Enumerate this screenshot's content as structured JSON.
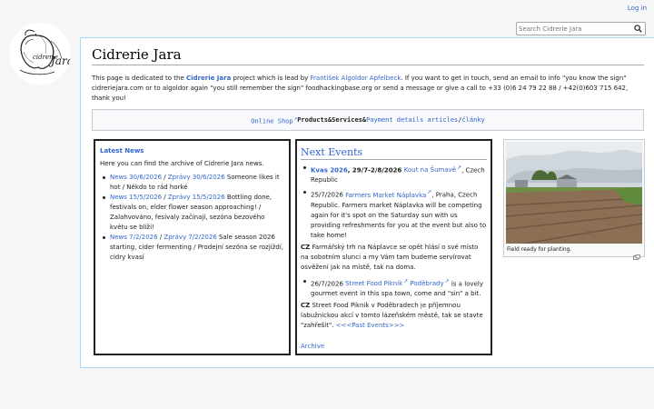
{
  "header": {
    "login_label": "Log in",
    "search_placeholder": "Search Cidrerie Jara"
  },
  "logo": {
    "text": "cidrerie Jara"
  },
  "page": {
    "title": "Cidrerie Jara",
    "intro": {
      "p1": "This page is dedicated to the ",
      "project_link": "Cidrerie Jara",
      "p2": " project which is lead by ",
      "person_link": "František Algoldor Apfelbeck",
      "p3": ". If you want to get in touch, send an email to info \"you know the sign\" cidreriejara.com or to algoldor again \"you still remember the sign\" foodhackingbase.org or send a message or give a call to +33 (0)6 24 79 22 88 / +42(0)603 715 642, thank you!"
    },
    "nav": {
      "online_shop": "Online Shop",
      "products": "Products",
      "services": "Services",
      "payment": "Payment details",
      "articles": "articles",
      "clanky": "články"
    }
  },
  "news": {
    "heading": "Latest News",
    "intro": "Here you can find the archive of Cidrerie Jara news.",
    "items": [
      {
        "link_en": "News 30/6/2026",
        "link_cz": "Zprávy 30/6/2026",
        "text": " Someone likes it hot / Někdo to rád horké"
      },
      {
        "link_en": "News 15/5/2026",
        "link_cz": "Zprávy 15/5/2026",
        "text": " Bottling done, festivals on, elder flower season approaching! / Zalahvováno, fesivaly začínají, sezóna bezového květu se blíží!"
      },
      {
        "link_en": "News 7/2/2026",
        "link_cz": "Zprávy 7/2/2026",
        "text": " Sale season 2026 starting, cider fermenting / Prodejní sezóna se rozjíždí, cidry kvasí"
      }
    ]
  },
  "events": {
    "heading": "Next Events",
    "items": [
      {
        "bold": "Kvas 2026",
        "date": ", 29/7-2/8/2026 ",
        "link": "Kout na Šumavě",
        "text": ", Czech Republic"
      },
      {
        "date": "25/7/2026 ",
        "link": "Farmers Market Náplavka",
        "text": ", Praha, Czech Republic. Farmers market Náplavka will be competing again for it's spot on the Saturday sun with us providing refreshments for you at the event but also to take home!"
      }
    ],
    "cz1_label": "CZ",
    "cz1_text": " Farmářský trh na Náplavce se opět hlásí o své místo na sobotním slunci a my Vám tam budeme servírovat osvěžení jak na místě, tak na doma.",
    "item3": {
      "date": "26/7/2026 ",
      "link1": "Street Food Piknik",
      "link2": "Poděbrady",
      "text": " is a lovely gourmet event in this spa town, come and \"sin\" a bit."
    },
    "cz2_label": "CZ",
    "cz2_text": " Street Food Piknik v Poděbradech je příjemnou labužnickou akcí v tomto lázeňském městě, tak se stavte \"zahřešit\". ",
    "past_link": "<<<Past Events>>>",
    "archive_link": "Archive"
  },
  "thumbnail": {
    "caption": "Field ready for planting."
  }
}
